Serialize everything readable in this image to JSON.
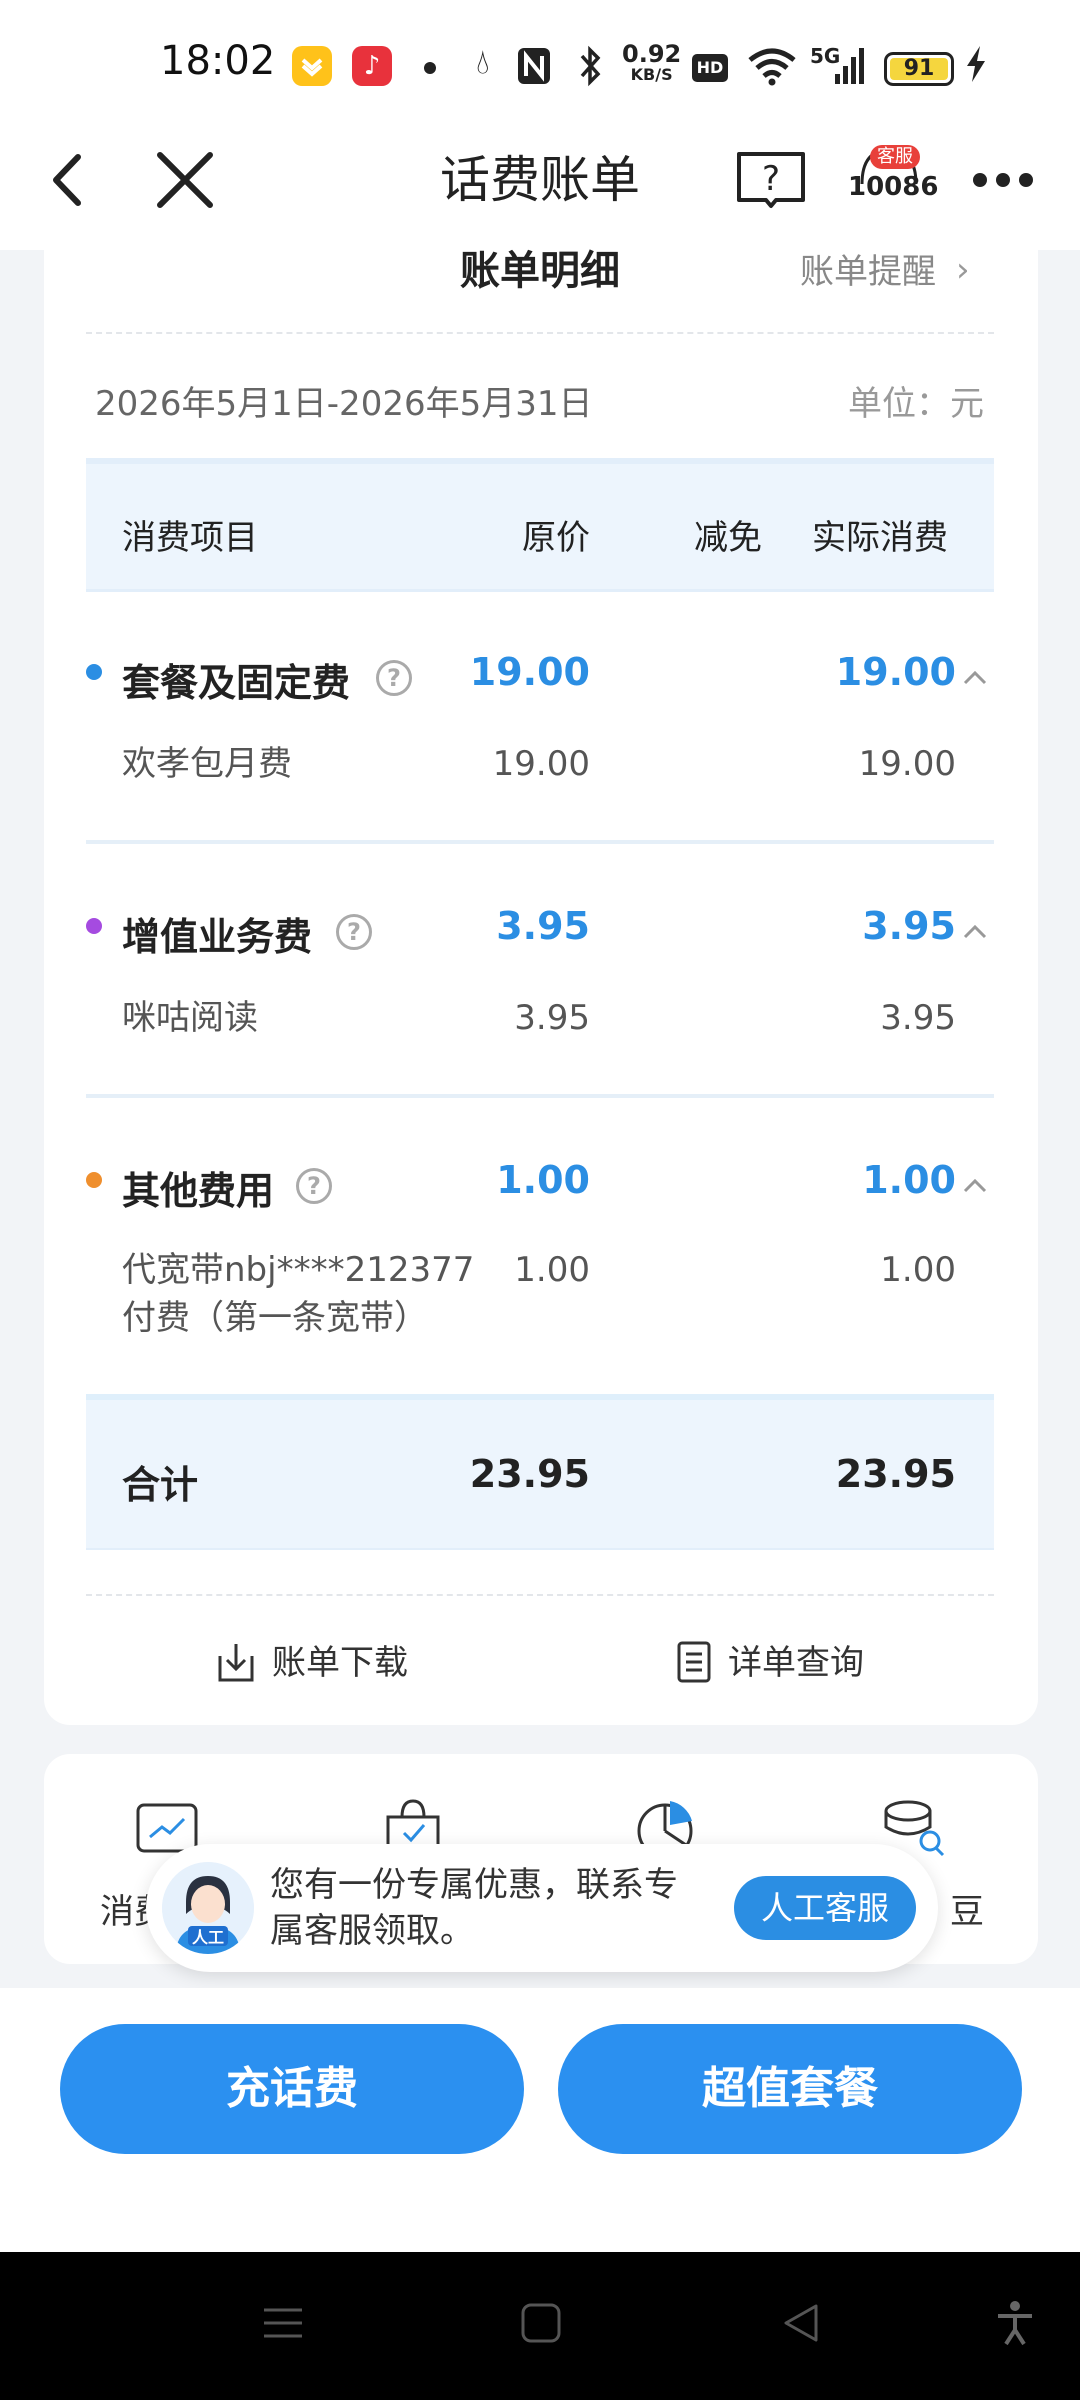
{
  "status_bar": {
    "time": "18:02",
    "app_icons": [
      "wallet-app-icon",
      "music-app-icon"
    ],
    "net_speed": "0.92",
    "net_speed_unit": "KB/S",
    "hd": "HD",
    "network": "5G",
    "battery": "91",
    "icons": [
      "drop-icon",
      "nfc-icon",
      "bluetooth-icon",
      "wifi-icon",
      "signal-icon",
      "battery-icon",
      "charging-icon"
    ]
  },
  "nav": {
    "title": "话费账单",
    "cs_badge": "客服",
    "cs_number": "10086"
  },
  "bill": {
    "title": "账单明细",
    "remind": "账单提醒",
    "period": "2026年5月1日-2026年5月31日",
    "unit": "单位：元",
    "columns": [
      "消费项目",
      "原价",
      "减免",
      "实际消费"
    ],
    "sections": [
      {
        "title": "套餐及固定费",
        "original": "19.00",
        "actual": "19.00",
        "dot_color": "#2b8ee3",
        "items": [
          {
            "name": "欢孝包月费",
            "original": "19.00",
            "actual": "19.00"
          }
        ]
      },
      {
        "title": "增值业务费",
        "original": "3.95",
        "actual": "3.95",
        "dot_color": "#a54be0",
        "items": [
          {
            "name": "咪咕阅读",
            "original": "3.95",
            "actual": "3.95"
          }
        ]
      },
      {
        "title": "其他费用",
        "original": "1.00",
        "actual": "1.00",
        "dot_color": "#ef8f2e",
        "items": [
          {
            "name_line1": "代宽带nbj****212377",
            "name_line2": "付费（第一条宽带）",
            "original": "1.00",
            "actual": "1.00"
          }
        ]
      }
    ],
    "total": {
      "label": "合计",
      "original": "23.95",
      "actual": "23.95"
    },
    "actions": {
      "download": "账单下载",
      "detail": "详单查询"
    }
  },
  "tools": {
    "left_label": "消费",
    "right_label": "豆"
  },
  "promo": {
    "text": "您有一份专属优惠，联系专属客服领取。",
    "avatar_badge": "人工",
    "button": "人工客服"
  },
  "buttons": {
    "recharge": "充话费",
    "package": "超值套餐"
  },
  "colors": {
    "accent": "#2b8ee3",
    "button": "#2b90f0"
  }
}
